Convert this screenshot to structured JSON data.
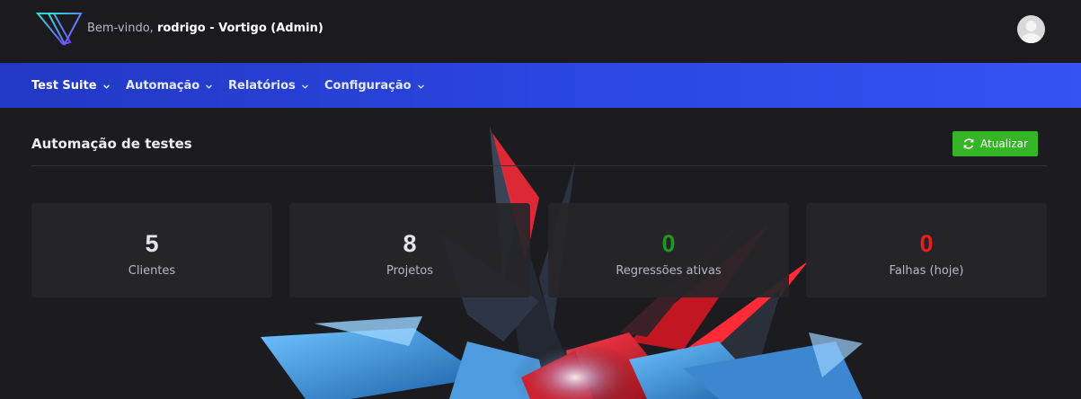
{
  "header": {
    "welcome_prefix": "Bem-vindo,",
    "user": "rodrigo - Vortigo (Admin)",
    "logo_icon": "vortigo-v-logo-icon",
    "avatar_icon": "user-avatar-icon"
  },
  "nav": {
    "items": [
      {
        "label": "Test Suite",
        "active": true
      },
      {
        "label": "Automação",
        "active": false
      },
      {
        "label": "Relatórios",
        "active": false
      },
      {
        "label": "Configuração",
        "active": false
      }
    ],
    "chevron_icon": "chevron-down-icon"
  },
  "main": {
    "title": "Automação de testes",
    "refresh_label": "Atualizar",
    "refresh_icon": "refresh-icon",
    "stats": [
      {
        "value": "5",
        "label": "Clientes",
        "color": "#e4e4ec"
      },
      {
        "value": "8",
        "label": "Projetos",
        "color": "#e4e4ec"
      },
      {
        "value": "0",
        "label": "Regressões ativas",
        "color": "#1f9a1f"
      },
      {
        "value": "0",
        "label": "Falhas (hoje)",
        "color": "#ee1c1c"
      }
    ]
  },
  "colors": {
    "nav_blue": "#2a45e0",
    "button_green": "#35b525",
    "success_green": "#1f9a1f",
    "danger_red": "#ee1c1c"
  }
}
